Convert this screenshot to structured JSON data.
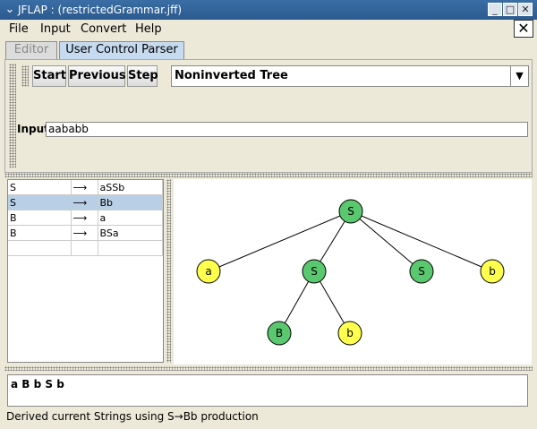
{
  "window": {
    "title": "JFLAP : (restrictedGrammar.jff)",
    "app_icon": "chevron-down-icon"
  },
  "window_controls": {
    "minimize": "_",
    "maximize": "□",
    "close": "✕"
  },
  "menu": {
    "items": [
      "File",
      "Input",
      "Convert",
      "Help"
    ],
    "close_glyph": "✕"
  },
  "tabs": [
    {
      "label": "Editor",
      "active": false
    },
    {
      "label": "User Control Parser",
      "active": true
    }
  ],
  "toolbar": {
    "start": "Start",
    "previous": "Previous",
    "step": "Step",
    "view_select": "Noninverted Tree",
    "dropdown_glyph": "▼"
  },
  "input": {
    "label": "Input",
    "value": "aababb"
  },
  "rules": [
    {
      "lhs": "S",
      "arrow": "⟶",
      "rhs": "aSSb",
      "selected": false
    },
    {
      "lhs": "S",
      "arrow": "⟶",
      "rhs": "Bb",
      "selected": true
    },
    {
      "lhs": "B",
      "arrow": "⟶",
      "rhs": "a",
      "selected": false
    },
    {
      "lhs": "B",
      "arrow": "⟶",
      "rhs": "BSa",
      "selected": false
    },
    {
      "lhs": "",
      "arrow": "",
      "rhs": "",
      "selected": false
    }
  ],
  "tree": {
    "colors": {
      "nonterminal": "#5ac86e",
      "terminal": "#ffff4d"
    },
    "nodes": [
      {
        "id": "n0",
        "label": "S",
        "kind": "nonterminal"
      },
      {
        "id": "n1",
        "label": "a",
        "kind": "terminal"
      },
      {
        "id": "n2",
        "label": "S",
        "kind": "nonterminal"
      },
      {
        "id": "n3",
        "label": "S",
        "kind": "nonterminal"
      },
      {
        "id": "n4",
        "label": "b",
        "kind": "terminal"
      },
      {
        "id": "n5",
        "label": "B",
        "kind": "nonterminal"
      },
      {
        "id": "n6",
        "label": "b",
        "kind": "terminal"
      }
    ],
    "edges": [
      [
        "n0",
        "n1"
      ],
      [
        "n0",
        "n2"
      ],
      [
        "n0",
        "n3"
      ],
      [
        "n0",
        "n4"
      ],
      [
        "n2",
        "n5"
      ],
      [
        "n2",
        "n6"
      ]
    ]
  },
  "derivation": {
    "text": "a B b S b"
  },
  "status": {
    "text": "Derived current Strings using S→Bb production"
  }
}
